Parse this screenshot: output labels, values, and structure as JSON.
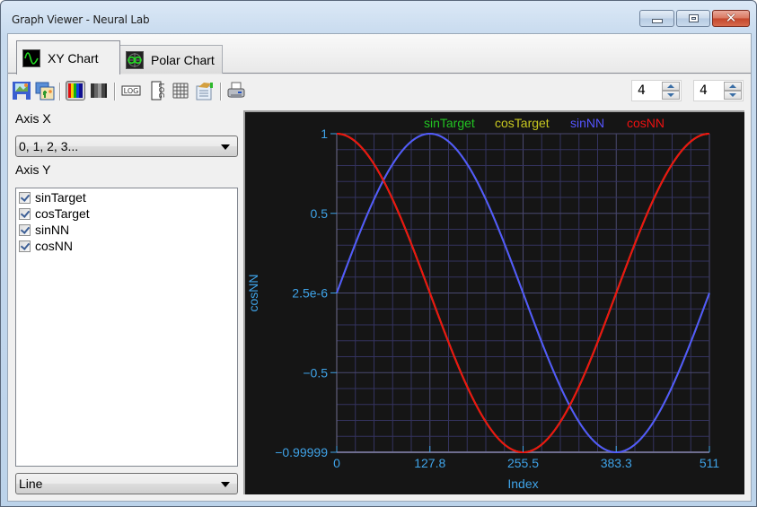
{
  "window": {
    "title": "Graph Viewer - Neural Lab",
    "controls": [
      "minimize",
      "maximize",
      "close"
    ]
  },
  "tabs": [
    {
      "label": "XY Chart",
      "icon": "sine-wave-icon",
      "active": true
    },
    {
      "label": "Polar Chart",
      "icon": "polar-chart-icon",
      "active": false
    }
  ],
  "toolbar": {
    "buttons": [
      {
        "name": "save-image",
        "icon": "save-image-icon"
      },
      {
        "name": "copy-image",
        "icon": "copy-image-icon"
      },
      {
        "name": "color-mode",
        "icon": "color-bars-icon",
        "pressed": true
      },
      {
        "name": "grayscale-mode",
        "icon": "grayscale-bars-icon"
      },
      {
        "name": "log-x",
        "icon": "log-x-icon"
      },
      {
        "name": "log-y",
        "icon": "log-y-icon"
      },
      {
        "name": "grid",
        "icon": "grid-icon"
      },
      {
        "name": "report",
        "icon": "report-icon"
      },
      {
        "name": "print",
        "icon": "printer-icon"
      }
    ],
    "spinners": [
      {
        "value": "4"
      },
      {
        "value": "4"
      }
    ]
  },
  "left_panel": {
    "axis_x_label": "Axis X",
    "axis_x_value": "0, 1, 2, 3...",
    "axis_y_label": "Axis Y",
    "series_list": [
      {
        "label": "sinTarget",
        "checked": true
      },
      {
        "label": "cosTarget",
        "checked": true
      },
      {
        "label": "sinNN",
        "checked": true
      },
      {
        "label": "cosNN",
        "checked": true
      }
    ],
    "chart_type_value": "Line"
  },
  "colors": {
    "plot_bg": "#151515",
    "grid": "#34335f",
    "axis": "#6e6d8e",
    "tick_text": "#3fa3e8",
    "sinTarget": "#22c422",
    "cosTarget": "#c8c820",
    "sinNN": "#5555ff",
    "cosNN": "#ee1111"
  },
  "chart_data": {
    "type": "line",
    "title": "",
    "xlabel": "Index",
    "ylabel": "cosNN",
    "xlim": [
      0,
      511
    ],
    "ylim": [
      -0.99999,
      1
    ],
    "x_ticks": [
      "0",
      "127.8",
      "255.5",
      "383.3",
      "511"
    ],
    "y_ticks": [
      "1",
      "0.5",
      "2.5e-6",
      "−0.5",
      "−0.99999"
    ],
    "grid": true,
    "minor_divisions": 5,
    "legend_position": "top-center",
    "x": "0..511 (index, 512 points)",
    "series": [
      {
        "name": "sinTarget",
        "formula": "sin(2*pi*i/511)",
        "color": "#22c422",
        "samples": {
          "0": 0,
          "127.8": 1,
          "255.5": 0,
          "383.3": -1,
          "511": 0
        }
      },
      {
        "name": "cosTarget",
        "formula": "cos(2*pi*i/511)",
        "color": "#c8c820",
        "samples": {
          "0": 1,
          "127.8": 0,
          "255.5": -1,
          "383.3": 0,
          "511": 1
        }
      },
      {
        "name": "sinNN",
        "formula": "sin(2*pi*i/511)",
        "color": "#5555ff",
        "samples": {
          "0": 0,
          "127.8": 1,
          "255.5": 0,
          "383.3": -1,
          "511": 0
        }
      },
      {
        "name": "cosNN",
        "formula": "cos(2*pi*i/511)",
        "color": "#ee1111",
        "samples": {
          "0": 1,
          "127.8": 0,
          "255.5": -1,
          "383.3": 0,
          "511": 1
        }
      }
    ],
    "n_points": 512
  }
}
